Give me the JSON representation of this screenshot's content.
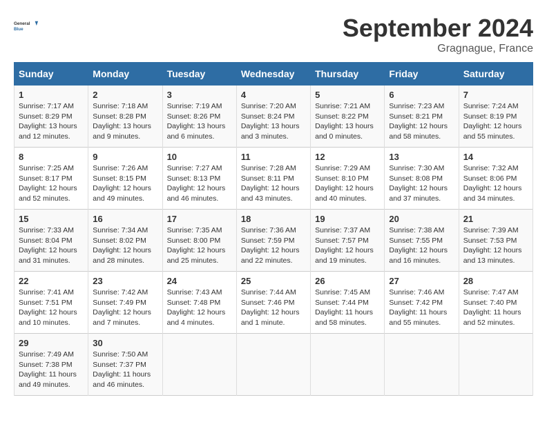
{
  "header": {
    "logo_line1": "General",
    "logo_line2": "Blue",
    "month_year": "September 2024",
    "location": "Gragnague, France"
  },
  "days_of_week": [
    "Sunday",
    "Monday",
    "Tuesday",
    "Wednesday",
    "Thursday",
    "Friday",
    "Saturday"
  ],
  "weeks": [
    [
      {
        "day": "1",
        "sunrise": "Sunrise: 7:17 AM",
        "sunset": "Sunset: 8:29 PM",
        "daylight": "Daylight: 13 hours and 12 minutes."
      },
      {
        "day": "2",
        "sunrise": "Sunrise: 7:18 AM",
        "sunset": "Sunset: 8:28 PM",
        "daylight": "Daylight: 13 hours and 9 minutes."
      },
      {
        "day": "3",
        "sunrise": "Sunrise: 7:19 AM",
        "sunset": "Sunset: 8:26 PM",
        "daylight": "Daylight: 13 hours and 6 minutes."
      },
      {
        "day": "4",
        "sunrise": "Sunrise: 7:20 AM",
        "sunset": "Sunset: 8:24 PM",
        "daylight": "Daylight: 13 hours and 3 minutes."
      },
      {
        "day": "5",
        "sunrise": "Sunrise: 7:21 AM",
        "sunset": "Sunset: 8:22 PM",
        "daylight": "Daylight: 13 hours and 0 minutes."
      },
      {
        "day": "6",
        "sunrise": "Sunrise: 7:23 AM",
        "sunset": "Sunset: 8:21 PM",
        "daylight": "Daylight: 12 hours and 58 minutes."
      },
      {
        "day": "7",
        "sunrise": "Sunrise: 7:24 AM",
        "sunset": "Sunset: 8:19 PM",
        "daylight": "Daylight: 12 hours and 55 minutes."
      }
    ],
    [
      {
        "day": "8",
        "sunrise": "Sunrise: 7:25 AM",
        "sunset": "Sunset: 8:17 PM",
        "daylight": "Daylight: 12 hours and 52 minutes."
      },
      {
        "day": "9",
        "sunrise": "Sunrise: 7:26 AM",
        "sunset": "Sunset: 8:15 PM",
        "daylight": "Daylight: 12 hours and 49 minutes."
      },
      {
        "day": "10",
        "sunrise": "Sunrise: 7:27 AM",
        "sunset": "Sunset: 8:13 PM",
        "daylight": "Daylight: 12 hours and 46 minutes."
      },
      {
        "day": "11",
        "sunrise": "Sunrise: 7:28 AM",
        "sunset": "Sunset: 8:11 PM",
        "daylight": "Daylight: 12 hours and 43 minutes."
      },
      {
        "day": "12",
        "sunrise": "Sunrise: 7:29 AM",
        "sunset": "Sunset: 8:10 PM",
        "daylight": "Daylight: 12 hours and 40 minutes."
      },
      {
        "day": "13",
        "sunrise": "Sunrise: 7:30 AM",
        "sunset": "Sunset: 8:08 PM",
        "daylight": "Daylight: 12 hours and 37 minutes."
      },
      {
        "day": "14",
        "sunrise": "Sunrise: 7:32 AM",
        "sunset": "Sunset: 8:06 PM",
        "daylight": "Daylight: 12 hours and 34 minutes."
      }
    ],
    [
      {
        "day": "15",
        "sunrise": "Sunrise: 7:33 AM",
        "sunset": "Sunset: 8:04 PM",
        "daylight": "Daylight: 12 hours and 31 minutes."
      },
      {
        "day": "16",
        "sunrise": "Sunrise: 7:34 AM",
        "sunset": "Sunset: 8:02 PM",
        "daylight": "Daylight: 12 hours and 28 minutes."
      },
      {
        "day": "17",
        "sunrise": "Sunrise: 7:35 AM",
        "sunset": "Sunset: 8:00 PM",
        "daylight": "Daylight: 12 hours and 25 minutes."
      },
      {
        "day": "18",
        "sunrise": "Sunrise: 7:36 AM",
        "sunset": "Sunset: 7:59 PM",
        "daylight": "Daylight: 12 hours and 22 minutes."
      },
      {
        "day": "19",
        "sunrise": "Sunrise: 7:37 AM",
        "sunset": "Sunset: 7:57 PM",
        "daylight": "Daylight: 12 hours and 19 minutes."
      },
      {
        "day": "20",
        "sunrise": "Sunrise: 7:38 AM",
        "sunset": "Sunset: 7:55 PM",
        "daylight": "Daylight: 12 hours and 16 minutes."
      },
      {
        "day": "21",
        "sunrise": "Sunrise: 7:39 AM",
        "sunset": "Sunset: 7:53 PM",
        "daylight": "Daylight: 12 hours and 13 minutes."
      }
    ],
    [
      {
        "day": "22",
        "sunrise": "Sunrise: 7:41 AM",
        "sunset": "Sunset: 7:51 PM",
        "daylight": "Daylight: 12 hours and 10 minutes."
      },
      {
        "day": "23",
        "sunrise": "Sunrise: 7:42 AM",
        "sunset": "Sunset: 7:49 PM",
        "daylight": "Daylight: 12 hours and 7 minutes."
      },
      {
        "day": "24",
        "sunrise": "Sunrise: 7:43 AM",
        "sunset": "Sunset: 7:48 PM",
        "daylight": "Daylight: 12 hours and 4 minutes."
      },
      {
        "day": "25",
        "sunrise": "Sunrise: 7:44 AM",
        "sunset": "Sunset: 7:46 PM",
        "daylight": "Daylight: 12 hours and 1 minute."
      },
      {
        "day": "26",
        "sunrise": "Sunrise: 7:45 AM",
        "sunset": "Sunset: 7:44 PM",
        "daylight": "Daylight: 11 hours and 58 minutes."
      },
      {
        "day": "27",
        "sunrise": "Sunrise: 7:46 AM",
        "sunset": "Sunset: 7:42 PM",
        "daylight": "Daylight: 11 hours and 55 minutes."
      },
      {
        "day": "28",
        "sunrise": "Sunrise: 7:47 AM",
        "sunset": "Sunset: 7:40 PM",
        "daylight": "Daylight: 11 hours and 52 minutes."
      }
    ],
    [
      {
        "day": "29",
        "sunrise": "Sunrise: 7:49 AM",
        "sunset": "Sunset: 7:38 PM",
        "daylight": "Daylight: 11 hours and 49 minutes."
      },
      {
        "day": "30",
        "sunrise": "Sunrise: 7:50 AM",
        "sunset": "Sunset: 7:37 PM",
        "daylight": "Daylight: 11 hours and 46 minutes."
      },
      {
        "day": "",
        "sunrise": "",
        "sunset": "",
        "daylight": ""
      },
      {
        "day": "",
        "sunrise": "",
        "sunset": "",
        "daylight": ""
      },
      {
        "day": "",
        "sunrise": "",
        "sunset": "",
        "daylight": ""
      },
      {
        "day": "",
        "sunrise": "",
        "sunset": "",
        "daylight": ""
      },
      {
        "day": "",
        "sunrise": "",
        "sunset": "",
        "daylight": ""
      }
    ]
  ]
}
